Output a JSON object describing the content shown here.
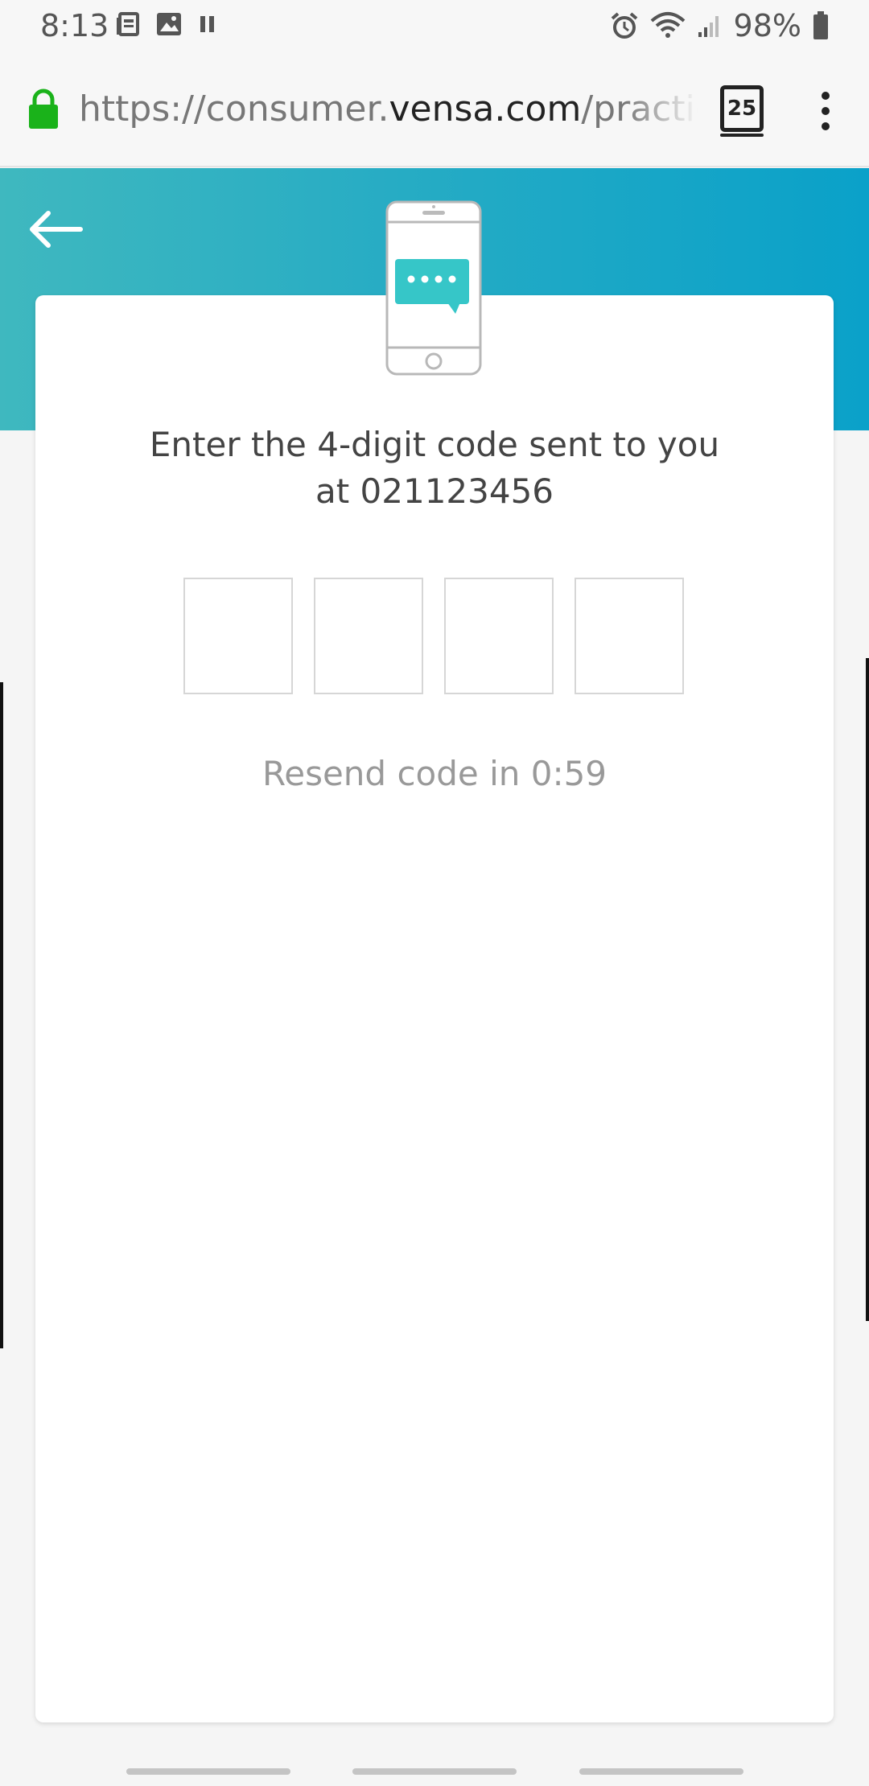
{
  "status_bar": {
    "time": "8:13",
    "battery": "98%",
    "icons": [
      "news-icon",
      "image-icon",
      "pause-icon",
      "alarm-icon",
      "wifi-icon",
      "signal-icon",
      "battery-icon"
    ]
  },
  "browser": {
    "url_prefix": "https://consumer.",
    "url_domain": "vensa.com",
    "url_suffix": "/practice",
    "tab_count": "25",
    "lock_color": "#1ab21a"
  },
  "header": {
    "gradient_start": "#3fb8bf",
    "gradient_end": "#0aa1c9"
  },
  "verification": {
    "instruction_line1": "Enter the 4-digit code sent to you",
    "instruction_line2": "at 021123456",
    "code_digits": [
      "",
      "",
      "",
      ""
    ],
    "resend_text": "Resend code in 0:59"
  },
  "colors": {
    "accent": "#36c6c8"
  }
}
